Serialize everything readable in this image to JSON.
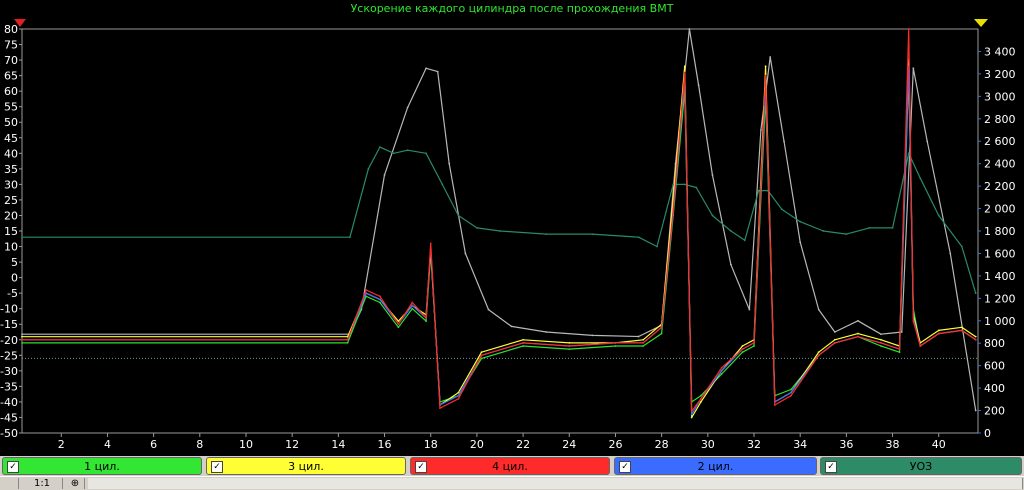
{
  "chart_data": {
    "type": "line",
    "title": "Ускорение каждого цилиндра после прохождения ВМТ",
    "x_ticks": [
      2,
      4,
      6,
      8,
      10,
      12,
      14,
      16,
      18,
      20,
      22,
      24,
      26,
      28,
      30,
      32,
      34,
      36,
      38,
      40
    ],
    "xlim": [
      0.3,
      41.7
    ],
    "y_left_ticks": [
      80,
      75,
      70,
      65,
      60,
      55,
      50,
      45,
      40,
      35,
      30,
      25,
      20,
      15,
      10,
      5,
      0,
      -5,
      -10,
      -15,
      -20,
      -25,
      -30,
      -35,
      -40,
      -45,
      -50
    ],
    "y_left_lim": [
      -50,
      80
    ],
    "y_right_ticks": [
      "3 400",
      "3 200",
      "3 000",
      "2 800",
      "2 600",
      "2 400",
      "2 200",
      "2 000",
      "1 800",
      "1 600",
      "1 400",
      "1 200",
      "1 000",
      "800",
      "600",
      "400",
      "200",
      "0"
    ],
    "y_right_lim": [
      0,
      3600
    ],
    "reference_line_y": -26,
    "series": [
      {
        "name": "1 цил.",
        "color": "#2fe12f",
        "axis": "left",
        "x": [
          0.3,
          14.4,
          15.2,
          15.8,
          16.6,
          17.2,
          17.8,
          18.0,
          18.4,
          19.2,
          20.2,
          22,
          24,
          26,
          27.2,
          28.0,
          28.5,
          29.0,
          29.3,
          29.7,
          30.6,
          31.5,
          32.0,
          32.5,
          32.9,
          33.6,
          34.8,
          35.5,
          36.5,
          37.5,
          38.3,
          38.7,
          38.9,
          39.2,
          40.0,
          41.0,
          41.6
        ],
        "y": [
          -21,
          -21,
          -6,
          -8,
          -16,
          -10,
          -14,
          8,
          -40,
          -38,
          -26,
          -22,
          -23,
          -22,
          -22,
          -18,
          20,
          60,
          -40,
          -38,
          -31,
          -24,
          -22,
          58,
          -38,
          -36,
          -25,
          -21,
          -19,
          -22,
          -24,
          65,
          -10,
          -22,
          -18,
          -17,
          -20
        ]
      },
      {
        "name": "3 цил.",
        "color": "#ffff33",
        "axis": "left",
        "x": [
          0.3,
          14.4,
          15.2,
          15.8,
          16.6,
          17.2,
          17.8,
          18.0,
          18.4,
          19.2,
          20.2,
          22,
          24,
          26,
          27.2,
          28.0,
          28.5,
          29.0,
          29.3,
          29.7,
          30.6,
          31.5,
          32.0,
          32.5,
          32.9,
          33.6,
          34.8,
          35.5,
          36.5,
          37.5,
          38.3,
          38.7,
          38.9,
          39.2,
          40.0,
          41.0,
          41.6
        ],
        "y": [
          -19,
          -19,
          -5,
          -7,
          -14,
          -9,
          -12,
          9,
          -41,
          -37,
          -24,
          -20,
          -21,
          -21,
          -20,
          -15,
          25,
          68,
          -45,
          -40,
          -30,
          -22,
          -20,
          68,
          -40,
          -37,
          -24,
          -20,
          -18,
          -20,
          -22,
          70,
          -12,
          -21,
          -17,
          -16,
          -19
        ]
      },
      {
        "name": "4 цил.",
        "color": "#ff2a2a",
        "axis": "left",
        "x": [
          0.3,
          14.4,
          15.2,
          15.8,
          16.6,
          17.2,
          17.8,
          18.0,
          18.4,
          19.2,
          20.2,
          22,
          24,
          26,
          27.2,
          28.0,
          28.5,
          29.0,
          29.3,
          29.7,
          30.6,
          31.5,
          32.0,
          32.5,
          32.9,
          33.6,
          34.8,
          35.5,
          36.5,
          37.5,
          38.3,
          38.7,
          38.9,
          39.2,
          40.0,
          41.0,
          41.6
        ],
        "y": [
          -20,
          -20,
          -4,
          -6,
          -15,
          -8,
          -13,
          11,
          -42,
          -39,
          -25,
          -21,
          -22,
          -21,
          -21,
          -16,
          22,
          66,
          -43,
          -39,
          -29,
          -23,
          -21,
          65,
          -41,
          -38,
          -25,
          -21,
          -19,
          -21,
          -23,
          80,
          -14,
          -22,
          -18,
          -17,
          -20
        ]
      },
      {
        "name": "2 цил.",
        "color": "#3a6cff",
        "axis": "left",
        "x": [
          0.3,
          14.4,
          15.2,
          15.8,
          16.6,
          17.2,
          17.8,
          18.0,
          18.4,
          19.2,
          20.2,
          22,
          24,
          26,
          27.2,
          28.0,
          28.5,
          29.0,
          29.3,
          29.7,
          30.6,
          31.5,
          32.0,
          32.5,
          32.9,
          33.6,
          34.8,
          35.5,
          36.5,
          37.5,
          38.3,
          38.7,
          38.9,
          39.2,
          40.0,
          41.0,
          41.6
        ],
        "y": [
          -20,
          -20,
          -5,
          -7,
          -15,
          -9,
          -13,
          10,
          -41,
          -38,
          -25,
          -21,
          -22,
          -21,
          -21,
          -16,
          21,
          64,
          -44,
          -39,
          -30,
          -23,
          -21,
          62,
          -40,
          -37,
          -25,
          -21,
          -19,
          -21,
          -23,
          68,
          -13,
          -22,
          -18,
          -17,
          -20
        ]
      },
      {
        "name": "УОЗ",
        "color": "#2a8a6a",
        "axis": "left",
        "x": [
          0.3,
          14.5,
          15.3,
          15.8,
          16.4,
          17.0,
          17.8,
          18.5,
          19.2,
          20.0,
          21.0,
          23.0,
          25.0,
          27.0,
          27.8,
          28.5,
          29.0,
          29.5,
          30.2,
          31.0,
          31.6,
          32.2,
          32.6,
          33.2,
          34.0,
          35.0,
          36.0,
          37.0,
          38.0,
          38.7,
          39.2,
          40.0,
          41.0,
          41.6
        ],
        "y": [
          13,
          13,
          35,
          42,
          40,
          41,
          40,
          30,
          20,
          16,
          15,
          14,
          14,
          13,
          10,
          30,
          30,
          29,
          20,
          15,
          12,
          28,
          28,
          22,
          18,
          15,
          14,
          16,
          16,
          40,
          32,
          20,
          10,
          -5
        ]
      },
      {
        "name": "",
        "color": "#b8b8b8",
        "axis": "right",
        "x": [
          0.3,
          14.5,
          15.0,
          16.0,
          17.0,
          17.8,
          18.3,
          18.8,
          19.5,
          20.5,
          21.5,
          23,
          25,
          27,
          28.0,
          28.6,
          29.2,
          29.6,
          30.2,
          31.0,
          31.8,
          32.3,
          32.7,
          33.3,
          34.0,
          34.8,
          35.5,
          36.5,
          37.5,
          38.4,
          38.9,
          39.5,
          40.5,
          41.6
        ],
        "y": [
          880,
          880,
          1100,
          2300,
          2900,
          3250,
          3220,
          2400,
          1600,
          1100,
          950,
          900,
          870,
          860,
          960,
          2400,
          3600,
          3100,
          2300,
          1500,
          1100,
          2700,
          3350,
          2600,
          1700,
          1100,
          900,
          1000,
          880,
          900,
          3250,
          2600,
          1600,
          200
        ]
      }
    ]
  },
  "legend": [
    {
      "label": "1 цил.",
      "color": "#33e633",
      "checked": "✓"
    },
    {
      "label": "3 цил.",
      "color": "#ffff33",
      "checked": "✓"
    },
    {
      "label": "4 цил.",
      "color": "#ff2a2a",
      "checked": "✓"
    },
    {
      "label": "2 цил.",
      "color": "#3a6cff",
      "checked": "✓"
    },
    {
      "label": "УОЗ",
      "color": "#2e8b67",
      "checked": "✓"
    }
  ],
  "status": {
    "zoom_label": "1:1"
  }
}
